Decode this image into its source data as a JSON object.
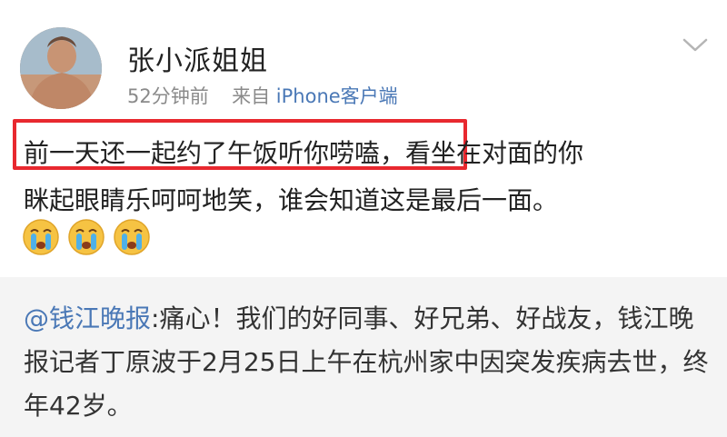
{
  "post": {
    "author": "张小派姐姐",
    "time": "52分钟前",
    "source_prefix": "来自",
    "client": "iPhone客户端",
    "text_line1": "前一天还一起约了午饭听你唠嗑，",
    "text_line1_rest": "看坐在对面的你",
    "text_line2": "眯起眼睛乐呵呵地笑，谁会知道这是最后一面。",
    "emojis": [
      "crying-face-icon",
      "crying-face-icon",
      "crying-face-icon"
    ]
  },
  "repost": {
    "mention": "@钱江晚报",
    "text": ":痛心！我们的好同事、好兄弟、好战友，钱江晚报记者丁原波于2月25日上午在杭州家中因突发疾病去世，终年42岁。"
  },
  "colors": {
    "link": "#4a78b6",
    "highlight": "#e8282f",
    "repost_bg": "#f4f4f4"
  }
}
